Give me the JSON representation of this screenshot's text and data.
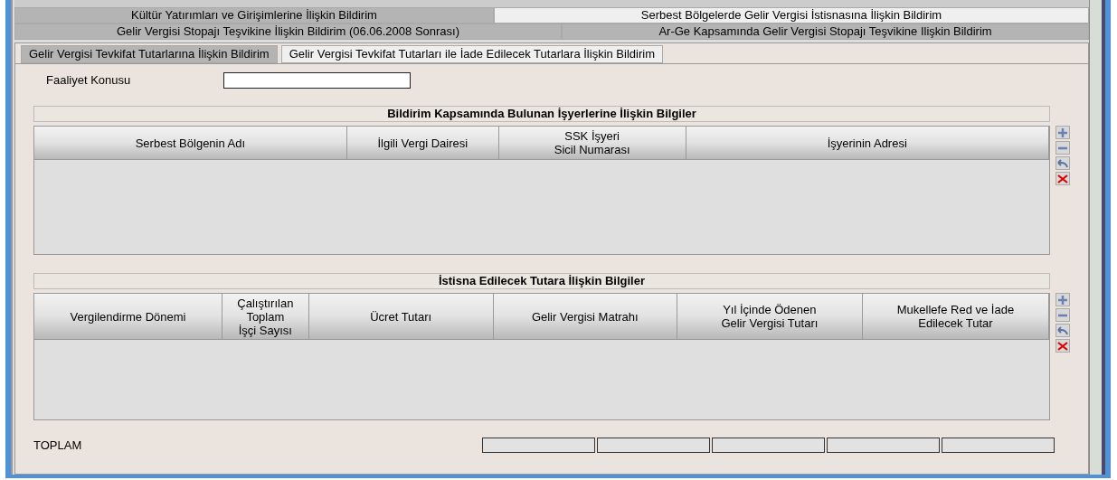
{
  "outer_tabs": {
    "rows": [
      [
        {
          "label": "Kültür Yatırımları ve Girişimlerine İlişkin Bildirim",
          "selected": false
        },
        {
          "label": "Serbest Bölgelerde Gelir Vergisi İstisnasına İlişkin Bildirim",
          "selected": true
        }
      ],
      [
        {
          "label": "Gelir Vergisi Stopajı Teşvikine İlişkin Bildirim (06.06.2008 Sonrası)",
          "selected": false
        },
        {
          "label": "Ar-Ge Kapsamında Gelir Vergisi Stopajı Teşvikine Ilişkin Bildirim",
          "selected": false
        }
      ]
    ]
  },
  "inner_tabs": [
    {
      "label": "Gelir Vergisi Tevkifat Tutarlarına İlişkin Bildirim",
      "selected": false
    },
    {
      "label": "Gelir Vergisi Tevkifat Tutarları ile İade Edilecek Tutarlara İlişkin Bildirim",
      "selected": true
    }
  ],
  "activity_field": {
    "label": "Faaliyet Konusu"
  },
  "workplaces": {
    "title": "Bildirim Kapsamında Bulunan İşyerlerine İlişkin Bilgiler",
    "columns": [
      "Serbest Bölgenin Adı",
      "İlgili Vergi Dairesi",
      "SSK İşyeri\nSicil Numarası",
      "İşyerinin Adresi"
    ]
  },
  "exemption": {
    "title": "İstisna Edilecek Tutara İlişkin Bilgiler",
    "columns": [
      "Vergilendirme Dönemi",
      "Çalıştırılan\nToplam\nİşçi Sayısı",
      "Ücret Tutarı",
      "Gelir Vergisi Matrahı",
      "Yıl İçinde Ödenen\nGelir Vergisi Tutarı",
      "Mukellefe Red ve İade\nEdilecek Tutar"
    ]
  },
  "totals": {
    "label": "TOPLAM"
  }
}
